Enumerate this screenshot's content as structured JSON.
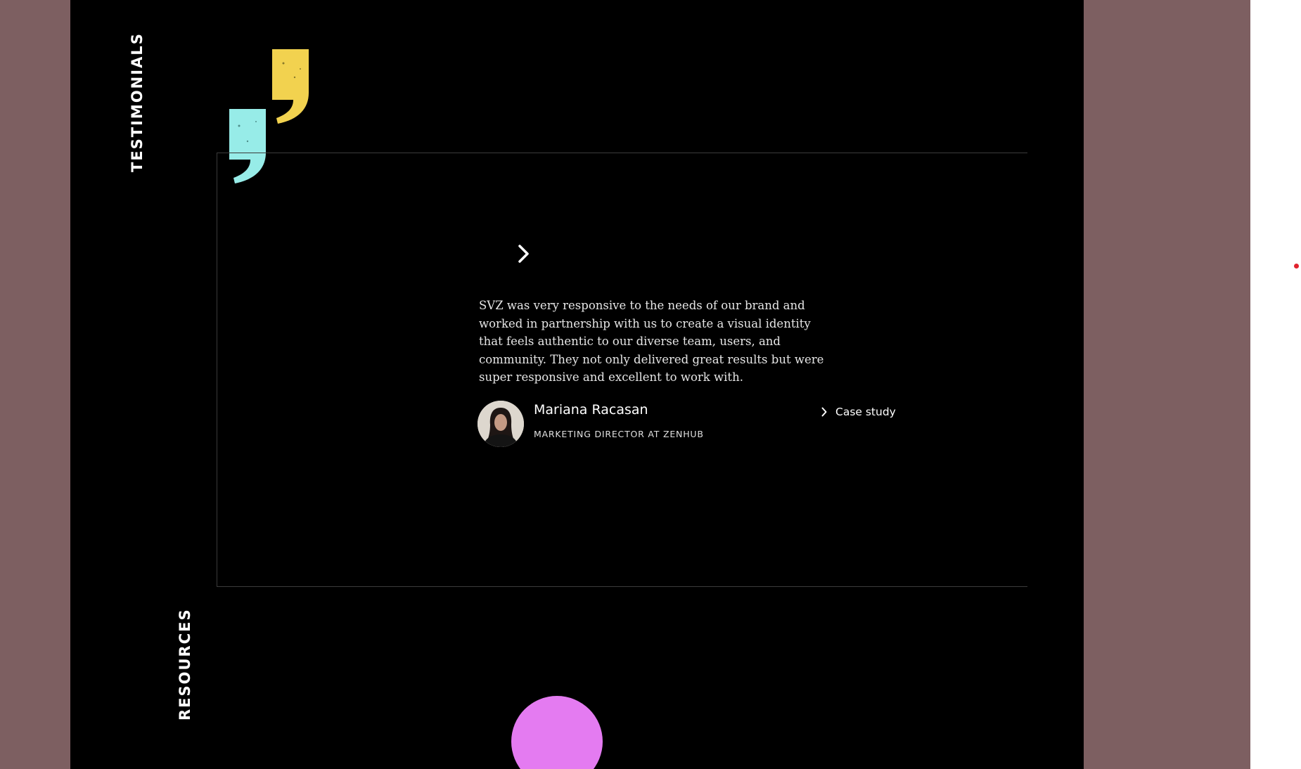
{
  "sections": {
    "testimonials_label": "TESTIMONIALS",
    "resources_label": "RESOURCES"
  },
  "testimonial": {
    "quote": "SVZ was very responsive to the needs of our brand and worked in partnership with us to create a visual identity that feels authentic to our diverse team, users, and community. They not only delivered great results but were super responsive and excellent to work with.",
    "author_name": "Mariana Racasan",
    "author_role": "MARKETING DIRECTOR AT ZENHUB",
    "case_study_label": "Case study"
  },
  "icons": {
    "next": "chevron-right-icon",
    "case_study": "chevron-right-icon",
    "quote_marks": "quote-icon"
  },
  "colors": {
    "page_side": "#7d5f61",
    "main_background": "#000000",
    "quote_yellow": "#f2d24f",
    "quote_cyan": "#97ece8",
    "accent_pink": "#e47bf1",
    "indicator_red": "#e1232e"
  }
}
